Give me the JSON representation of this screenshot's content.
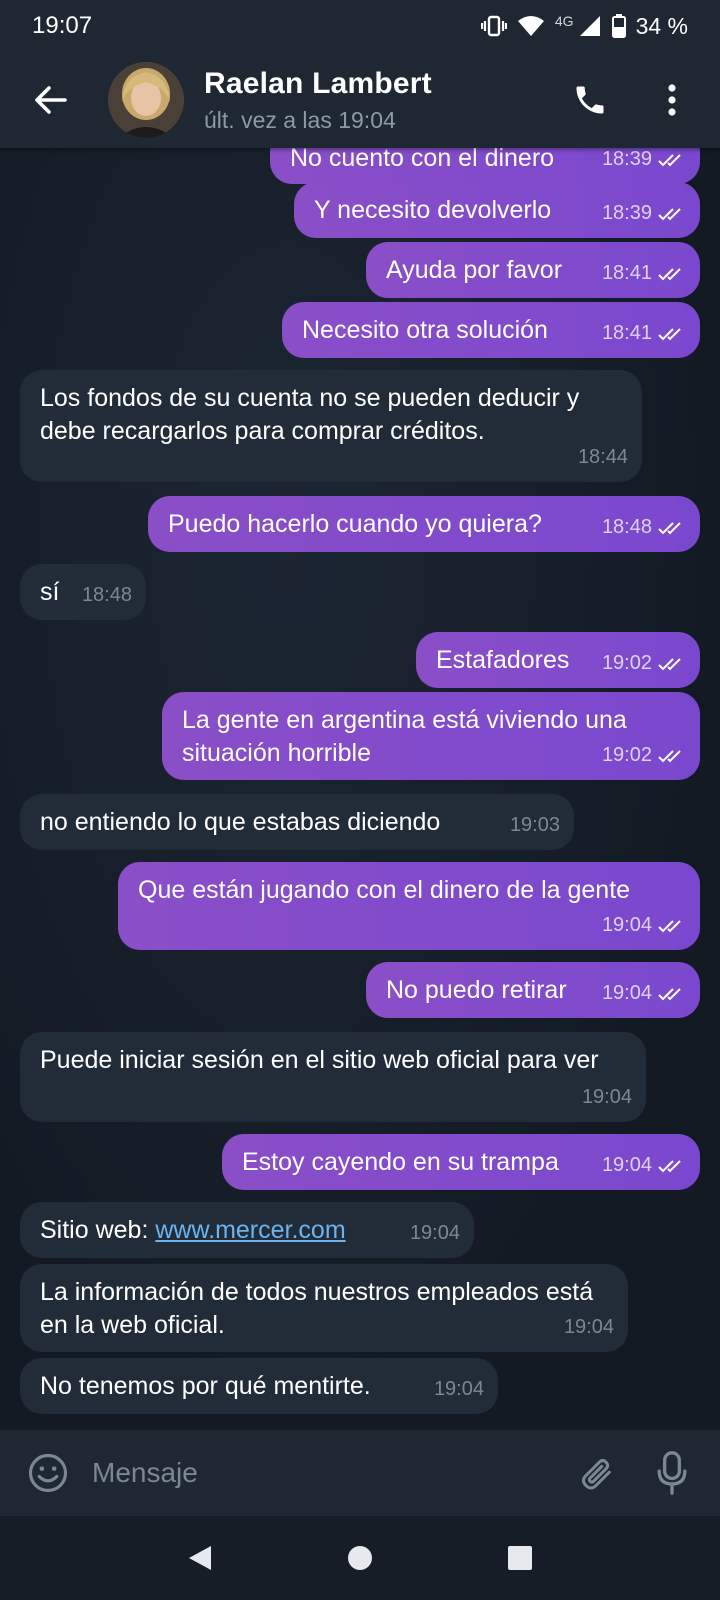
{
  "status_bar": {
    "time": "19:07",
    "network": "4G",
    "battery": "34 %"
  },
  "header": {
    "contact_name": "Raelan Lambert",
    "last_seen": "últ. vez a las 19:04",
    "icons": [
      "back-arrow-icon",
      "phone-icon",
      "more-vert-icon"
    ]
  },
  "messages": [
    {
      "dir": "out",
      "text": "No cuento con el dinero",
      "time": "18:39"
    },
    {
      "dir": "out",
      "text": "Y necesito devolverlo",
      "time": "18:39"
    },
    {
      "dir": "out",
      "text": "Ayuda por favor",
      "time": "18:41"
    },
    {
      "dir": "out",
      "text": "Necesito otra solución",
      "time": "18:41"
    },
    {
      "dir": "in",
      "text": "Los fondos de su cuenta no se pueden deducir y debe recargarlos para comprar créditos.",
      "time": "18:44"
    },
    {
      "dir": "out",
      "text": "Puedo hacerlo cuando yo quiera?",
      "time": "18:48"
    },
    {
      "dir": "in",
      "text": "sí",
      "time": "18:48"
    },
    {
      "dir": "out",
      "text": "Estafadores",
      "time": "19:02"
    },
    {
      "dir": "out",
      "text": "La gente en argentina está viviendo una situación horrible",
      "time": "19:02"
    },
    {
      "dir": "in",
      "text": "no entiendo lo que estabas diciendo",
      "time": "19:03"
    },
    {
      "dir": "out",
      "text": "Que están jugando con el dinero de la gente",
      "time": "19:04"
    },
    {
      "dir": "out",
      "text": "No puedo retirar",
      "time": "19:04"
    },
    {
      "dir": "in",
      "text": "Puede iniciar sesión en el sitio web oficial para ver",
      "time": "19:04"
    },
    {
      "dir": "out",
      "text": "Estoy cayendo en su trampa",
      "time": "19:04"
    },
    {
      "dir": "in",
      "text": "Sitio web: ",
      "link": "www.mercer.com",
      "time": "19:04"
    },
    {
      "dir": "in",
      "text": "La información de todos nuestros empleados está en la web oficial.",
      "time": "19:04"
    },
    {
      "dir": "in",
      "text": "No tenemos por qué mentirte.",
      "time": "19:04"
    }
  ],
  "input": {
    "placeholder": "Mensaje",
    "icons": [
      "emoji-icon",
      "attach-icon",
      "mic-icon"
    ]
  },
  "nav": {
    "icons": [
      "nav-back-icon",
      "nav-home-icon",
      "nav-recents-icon"
    ]
  },
  "colors": {
    "outgoing_bubble": "#8a4ec7",
    "incoming_bubble": "#222b38",
    "header_bg": "#1e2732",
    "link": "#6bb3f0"
  }
}
